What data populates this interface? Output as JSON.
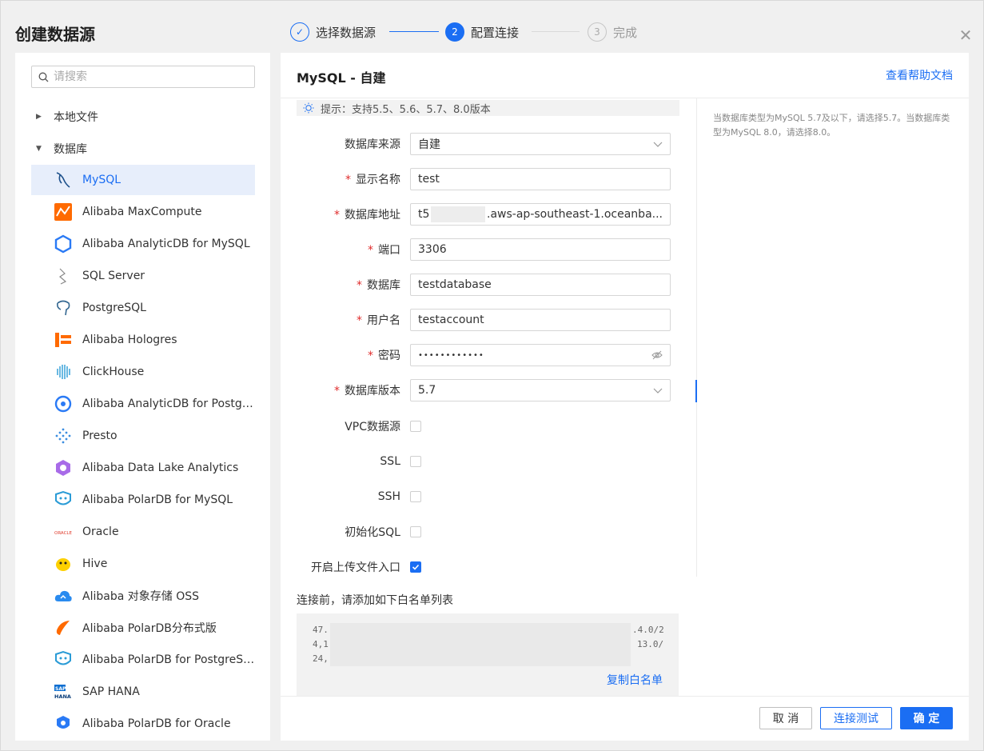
{
  "dialog": {
    "title": "创建数据源",
    "close_icon": "close-icon"
  },
  "steps": [
    {
      "marker": "✓",
      "label": "选择数据源",
      "state": "done"
    },
    {
      "marker": "2",
      "label": "配置连接",
      "state": "active"
    },
    {
      "marker": "3",
      "label": "完成",
      "state": "pending"
    }
  ],
  "sidebar": {
    "search_placeholder": "请搜索",
    "tree": {
      "local_files": "本地文件",
      "database": "数据库"
    },
    "items": [
      {
        "label": "MySQL",
        "icon": "mysql-dolphin-icon",
        "selected": true
      },
      {
        "label": "Alibaba MaxCompute",
        "icon": "maxcompute-icon"
      },
      {
        "label": "Alibaba AnalyticDB for MySQL",
        "icon": "analyticdb-icon"
      },
      {
        "label": "SQL Server",
        "icon": "sqlserver-icon"
      },
      {
        "label": "PostgreSQL",
        "icon": "postgresql-elephant-icon"
      },
      {
        "label": "Alibaba Hologres",
        "icon": "hologres-icon"
      },
      {
        "label": "ClickHouse",
        "icon": "clickhouse-icon"
      },
      {
        "label": "Alibaba AnalyticDB for Postgre...",
        "icon": "analyticdb-postgres-icon"
      },
      {
        "label": "Presto",
        "icon": "presto-icon"
      },
      {
        "label": "Alibaba Data Lake Analytics",
        "icon": "data-lake-analytics-icon"
      },
      {
        "label": "Alibaba PolarDB for MySQL",
        "icon": "polardb-icon"
      },
      {
        "label": "Oracle",
        "icon": "oracle-icon"
      },
      {
        "label": "Hive",
        "icon": "hive-icon"
      },
      {
        "label": "Alibaba 对象存储 OSS",
        "icon": "oss-cloud-icon"
      },
      {
        "label": "Alibaba PolarDB分布式版",
        "icon": "polardb-distributed-icon"
      },
      {
        "label": "Alibaba PolarDB for PostgreSQL",
        "icon": "polardb-postgres-icon"
      },
      {
        "label": "SAP HANA",
        "icon": "sap-hana-icon"
      },
      {
        "label": "Alibaba PolarDB for Oracle",
        "icon": "polardb-oracle-icon"
      }
    ]
  },
  "main": {
    "title": "MySQL - 自建",
    "help_link": "查看帮助文档",
    "tip": "提示：支持5.5、5.6、5.7、8.0版本",
    "side_note": "当数据库类型为MySQL 5.7及以下，请选择5.7。当数据库类型为MySQL 8.0，请选择8.0。",
    "form": {
      "source": {
        "label": "数据库来源",
        "value": "自建"
      },
      "display_name": {
        "label": "显示名称",
        "value": "test"
      },
      "host": {
        "label": "数据库地址",
        "value_prefix": "t5",
        "value_suffix": ".aws-ap-southeast-1.oceanba..."
      },
      "port": {
        "label": "端口",
        "value": "3306"
      },
      "database": {
        "label": "数据库",
        "value": "testdatabase"
      },
      "username": {
        "label": "用户名",
        "value": "testaccount"
      },
      "password": {
        "label": "密码",
        "value": "••••••••••••"
      },
      "version": {
        "label": "数据库版本",
        "value": "5.7"
      },
      "vpc": {
        "label": "VPC数据源",
        "checked": false
      },
      "ssl": {
        "label": "SSL",
        "checked": false
      },
      "ssh": {
        "label": "SSH",
        "checked": false
      },
      "init_sql": {
        "label": "初始化SQL",
        "checked": false
      },
      "upload": {
        "label": "开启上传文件入口",
        "checked": true
      }
    },
    "whitelist": {
      "title": "连接前，请添加如下白名单列表",
      "lines": [
        {
          "start": "47.",
          "end": ".4.0/2"
        },
        {
          "start": "4,1",
          "end": "13.0/"
        },
        {
          "start": "24,",
          "end": ""
        }
      ],
      "copy_label": "复制白名单"
    },
    "buttons": {
      "cancel": "取 消",
      "test": "连接测试",
      "ok": "确 定"
    }
  },
  "colors": {
    "accent": "#1b6ef3",
    "required": "#e02d2d",
    "selected_bg": "#e7eefb"
  }
}
